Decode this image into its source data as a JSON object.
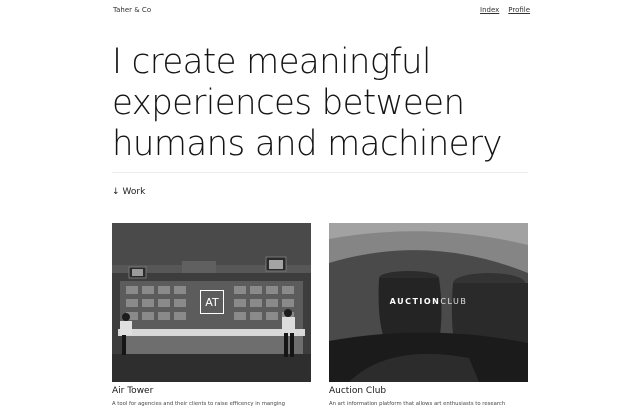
{
  "header": {
    "brand": "Taher & Co",
    "nav": [
      {
        "label": "Index"
      },
      {
        "label": "Profile"
      }
    ]
  },
  "hero": {
    "lines": [
      "I create meaningful",
      "experiences between",
      "humans and machinery"
    ]
  },
  "section": {
    "arrow": "↓",
    "label": "Work"
  },
  "projects": [
    {
      "title": "Air Tower",
      "logo_text": "AT",
      "description": "A tool for agencies and their clients to raise efficency in manging"
    },
    {
      "title": "Auction Club",
      "logo_bold": "AUCTION",
      "logo_light": "CLUB",
      "description": "An art information platform that allows art enthusiasts to research"
    }
  ],
  "colors": {
    "background": "#ffffff",
    "text": "#141414",
    "divider": "#ececec"
  }
}
